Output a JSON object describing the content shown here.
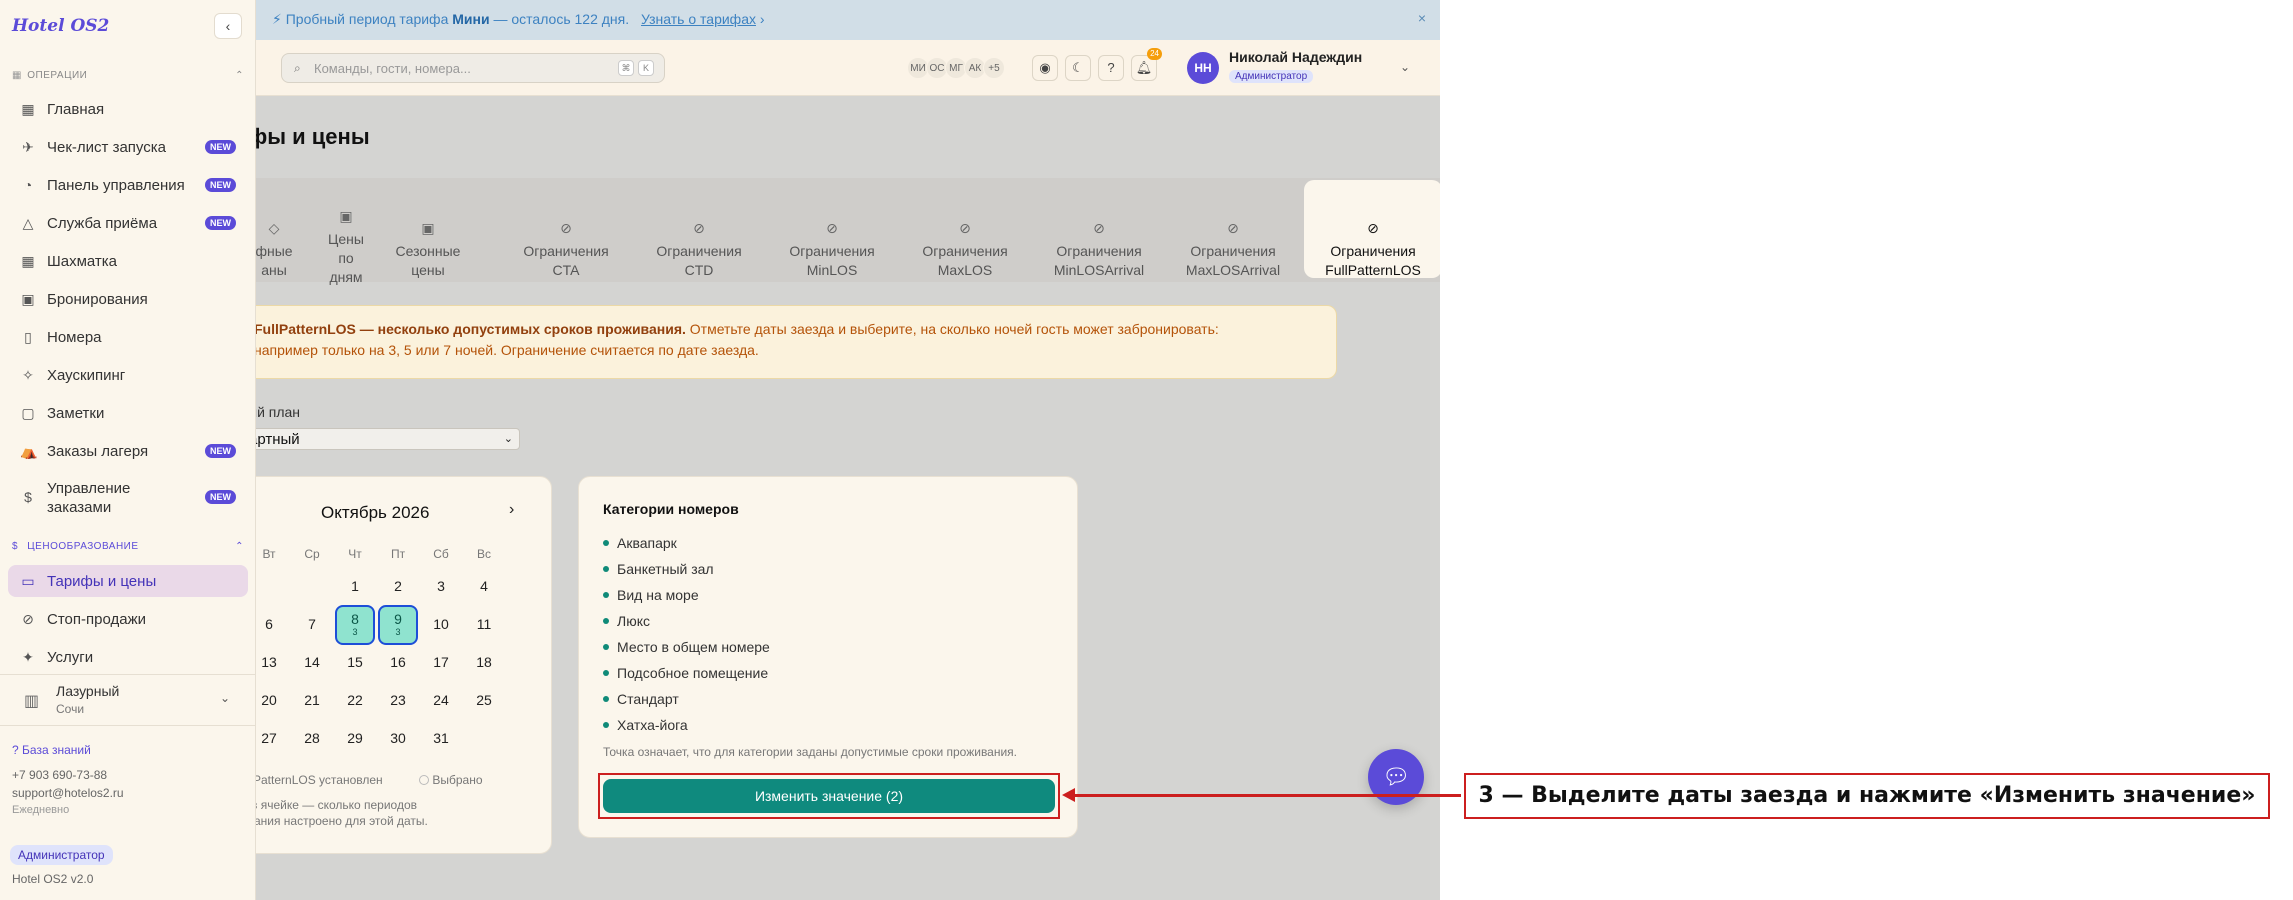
{
  "sidebar": {
    "logo": "Hotel OS2",
    "collapse_icon": "chevron-left-icon",
    "sections": [
      {
        "title": "Операции",
        "icon": "grid-icon"
      },
      {
        "title": "Ценообразование",
        "icon": "dollar-icon"
      }
    ],
    "items": [
      {
        "label": "Главная",
        "icon": "dashboard-icon"
      },
      {
        "label": "Чек-лист запуска",
        "icon": "rocket-icon",
        "badge": "NEW"
      },
      {
        "label": "Панель управления",
        "icon": "gauge-icon",
        "badge": "NEW"
      },
      {
        "label": "Служба приёма",
        "icon": "bell-icon",
        "badge": "NEW"
      },
      {
        "label": "Шахматка",
        "icon": "grid-icon"
      },
      {
        "label": "Бронирования",
        "icon": "calendar-icon"
      },
      {
        "label": "Номера",
        "icon": "door-icon"
      },
      {
        "label": "Хаускипинг",
        "icon": "sparkle-icon"
      },
      {
        "label": "Заметки",
        "icon": "note-icon"
      },
      {
        "label": "Заказы лагеря",
        "icon": "tent-icon",
        "badge": "NEW"
      },
      {
        "label": "Управление заказами",
        "icon": "receipt-icon",
        "badge": "NEW"
      },
      {
        "label": "Тарифы и цены",
        "icon": "card-icon"
      },
      {
        "label": "Стоп-продажи",
        "icon": "stop-icon"
      },
      {
        "label": "Услуги",
        "icon": "service-icon"
      }
    ],
    "hotel": {
      "name": "Лазурный",
      "city": "Сочи"
    },
    "footer": {
      "knowledge_base": "База знаний",
      "phone": "+7 903 690-73-88",
      "email": "support@hotelos2.ru",
      "schedule": "Ежедневно",
      "role": "Администратор",
      "version": "Hotel OS2 v2.0"
    }
  },
  "banner": {
    "text_prefix": "Пробный период тарифа",
    "plan": "Мини",
    "text_suffix": "— осталось 122 дня.",
    "link": "Узнать о тарифах",
    "link_arrow": "›",
    "close": "×"
  },
  "header": {
    "search_placeholder": "Команды, гости, номера...",
    "kbd1": "⌘",
    "kbd2": "K",
    "avatars": [
      "МИ",
      "ОС",
      "МГ",
      "АК",
      "+5"
    ],
    "notif_count": "24",
    "user_initials": "НН",
    "user_name": "Николай Надеждин",
    "user_role": "Администратор"
  },
  "main": {
    "title": "фы и цены",
    "tabs": [
      {
        "label": "фные\nаны"
      },
      {
        "label": "Цены\nпо\nдням"
      },
      {
        "label": "Сезонные\nцены"
      },
      {
        "label": "Ограничения\nCTA"
      },
      {
        "label": "Ограничения\nCTD"
      },
      {
        "label": "Ограничения\nMinLOS"
      },
      {
        "label": "Ограничения\nMaxLOS"
      },
      {
        "label": "Ограничения\nMinLOSArrival"
      },
      {
        "label": "Ограничения\nMaxLOSArrival"
      },
      {
        "label": "Ограничения\nFullPatternLOS"
      }
    ],
    "notice_bold": "FullPatternLOS — несколько допустимых сроков проживания.",
    "notice_text1": "Отметьте даты заезда и выберите, на сколько ночей гость может забронировать:",
    "notice_text2": "например только на 3, 5 или 7 ночей. Ограничение считается по дате заезда.",
    "plan_label": "ый план",
    "plan_value": "артный",
    "calendar": {
      "month": "Октябрь 2026",
      "next": "›",
      "weekdays": [
        "Вт",
        "Ср",
        "Чт",
        "Пт",
        "Сб",
        "Вс"
      ],
      "weeks": [
        [
          "",
          "",
          "1",
          "2",
          "3",
          "4"
        ],
        [
          "6",
          "7",
          "8",
          "9",
          "10",
          "11"
        ],
        [
          "13",
          "14",
          "15",
          "16",
          "17",
          "18"
        ],
        [
          "20",
          "21",
          "22",
          "23",
          "24",
          "25"
        ],
        [
          "27",
          "28",
          "29",
          "30",
          "31",
          ""
        ]
      ],
      "selected": {
        "8": "3",
        "9": "3"
      },
      "legend_set": "ullPatternLOS установлен",
      "legend_selected": "Выбрано",
      "hint": "а в ячейке — сколько периодов\nивания настроено для этой даты."
    },
    "rooms": {
      "title": "Категории номеров",
      "items": [
        "Аквапарк",
        "Банкетный зал",
        "Вид на море",
        "Люкс",
        "Место в общем номере",
        "Подсобное помещение",
        "Стандарт",
        "Хатха-йога"
      ],
      "hint": "Точка означает, что для категории заданы допустимые сроки проживания.",
      "button": "Изменить значение (2)"
    }
  },
  "callout": "3 — Выделите даты заезда и нажмите «Изменить значение»",
  "colors": {
    "accent": "#5b4bd8",
    "teal": "#0f8a7e",
    "annotation": "#cc1f1f"
  }
}
